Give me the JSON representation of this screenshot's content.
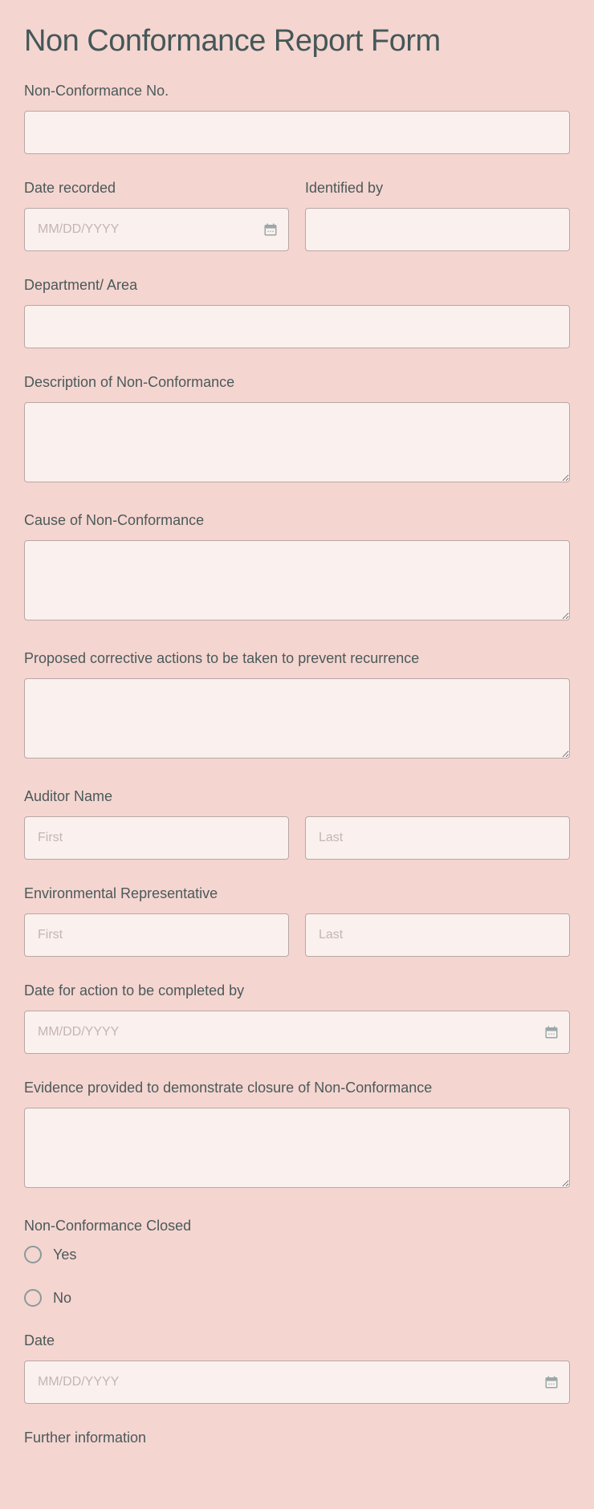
{
  "title": "Non Conformance Report Form",
  "fields": {
    "ncNo": {
      "label": "Non-Conformance No."
    },
    "dateRecorded": {
      "label": "Date recorded",
      "placeholder": "MM/DD/YYYY"
    },
    "identifiedBy": {
      "label": "Identified by"
    },
    "department": {
      "label": "Department/ Area"
    },
    "description": {
      "label": "Description of Non-Conformance"
    },
    "cause": {
      "label": "Cause of Non-Conformance"
    },
    "proposed": {
      "label": "Proposed corrective actions to be taken to prevent recurrence"
    },
    "auditorName": {
      "label": "Auditor Name",
      "firstPlaceholder": "First",
      "lastPlaceholder": "Last"
    },
    "envRep": {
      "label": "Environmental Representative",
      "firstPlaceholder": "First",
      "lastPlaceholder": "Last"
    },
    "actionDate": {
      "label": "Date for action to be completed by",
      "placeholder": "MM/DD/YYYY"
    },
    "evidence": {
      "label": "Evidence provided to demonstrate closure of Non-Conformance"
    },
    "closed": {
      "label": "Non-Conformance Closed",
      "optYes": "Yes",
      "optNo": "No"
    },
    "date": {
      "label": "Date",
      "placeholder": "MM/DD/YYYY"
    },
    "further": {
      "label": "Further information"
    }
  }
}
